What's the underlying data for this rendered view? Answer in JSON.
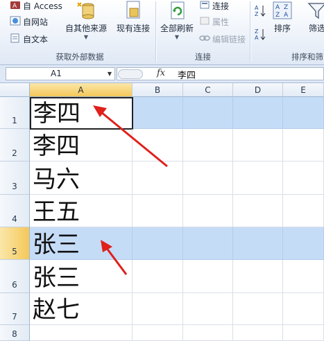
{
  "ribbon": {
    "get_external": {
      "access_label": "自 Access",
      "web_label": "自网站",
      "text_label": "自文本",
      "other_sources_label": "自其他来源",
      "existing_conn_label": "现有连接",
      "group_label": "获取外部数据"
    },
    "connections": {
      "refresh_all_label": "全部刷新",
      "connections_label": "连接",
      "properties_label": "属性",
      "edit_links_label": "编辑链接",
      "group_label": "连接"
    },
    "sort_filter": {
      "sort_label": "排序",
      "filter_label": "筛选",
      "group_label": "排序和筛"
    }
  },
  "formula_bar": {
    "name_box": "A1",
    "fx": "fx",
    "value": "李四"
  },
  "grid": {
    "columns": [
      "A",
      "B",
      "C",
      "D",
      "E"
    ],
    "rows": [
      {
        "num": "1",
        "a": "李四"
      },
      {
        "num": "2",
        "a": "李四"
      },
      {
        "num": "3",
        "a": "马六"
      },
      {
        "num": "4",
        "a": "王五"
      },
      {
        "num": "5",
        "a": "张三"
      },
      {
        "num": "6",
        "a": "张三"
      },
      {
        "num": "7",
        "a": "赵七"
      },
      {
        "num": "8",
        "a": ""
      }
    ],
    "selected_column": "A",
    "selected_row": "5",
    "active_cell": "A1",
    "highlight_color": "#c5dcf7",
    "arrow_color": "#e0201b"
  }
}
